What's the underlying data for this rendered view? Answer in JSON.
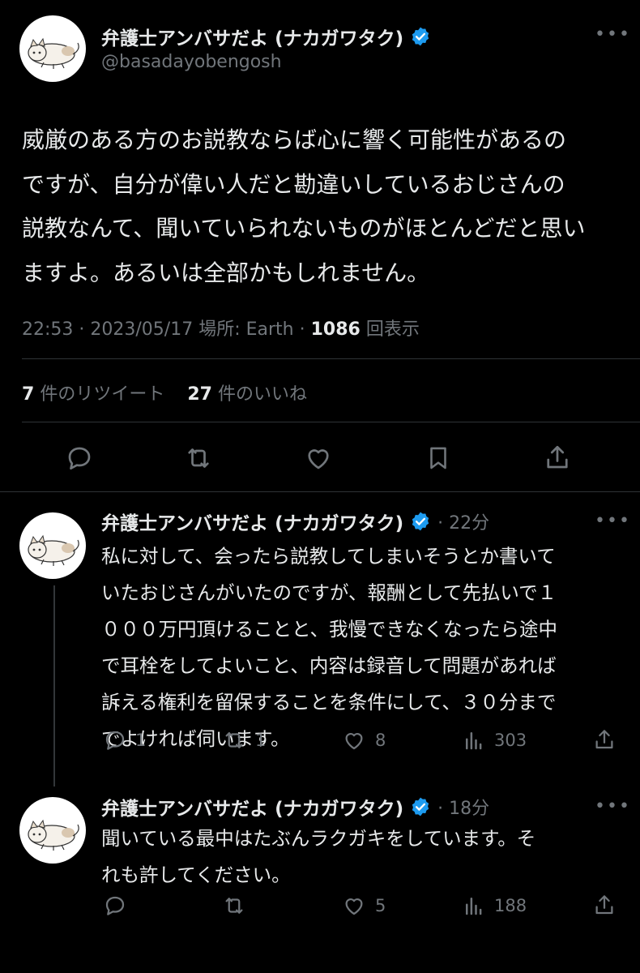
{
  "main_tweet": {
    "author_name": "弁護士アンバサだよ (ナカガワタク)",
    "handle": "@basadayobengosh",
    "text_lines": [
      "威厳のある方のお説教ならば心に響く可能性があるの",
      "ですが、自分が偉い人だと勘違いしているおじさんの",
      "説教なんて、聞いていられないものがほとんどだと思い",
      "ますよ。あるいは全部かもしれません。"
    ],
    "time": "22:53",
    "date": "2023/05/17",
    "location_label": "場所: Earth",
    "views_count": "1086",
    "views_label": "回表示",
    "retweets_count": "7",
    "retweets_label": "件のリツイート",
    "likes_count": "27",
    "likes_label": "件のいいね"
  },
  "replies": [
    {
      "author_name": "弁護士アンバサだよ (ナカガワタク)",
      "time_ago": "22分",
      "text_lines": [
        "私に対して、会ったら説教してしまいそうとか書いて",
        "いたおじさんがいたのですが、報酬として先払いで１",
        "０００万円頂けることと、我慢できなくなったら途中",
        "で耳栓をしてよいこと、内容は録音して問題があれば",
        "訴える権利を留保することを条件にして、３０分まで",
        "でよければ伺います。"
      ],
      "replies_count": "1",
      "retweets_count": "1",
      "likes_count": "8",
      "views_count": "303"
    },
    {
      "author_name": "弁護士アンバサだよ (ナカガワタク)",
      "time_ago": "18分",
      "text_lines": [
        "聞いている最中はたぶんラクガキをしています。そ",
        "れも許してください。"
      ],
      "replies_count": "",
      "retweets_count": "",
      "likes_count": "5",
      "views_count": "188"
    }
  ],
  "colors": {
    "background": "#000000",
    "text": "#e7e9ea",
    "secondary": "#71767b",
    "verified": "#1d9bf0",
    "divider": "#2f3336"
  }
}
